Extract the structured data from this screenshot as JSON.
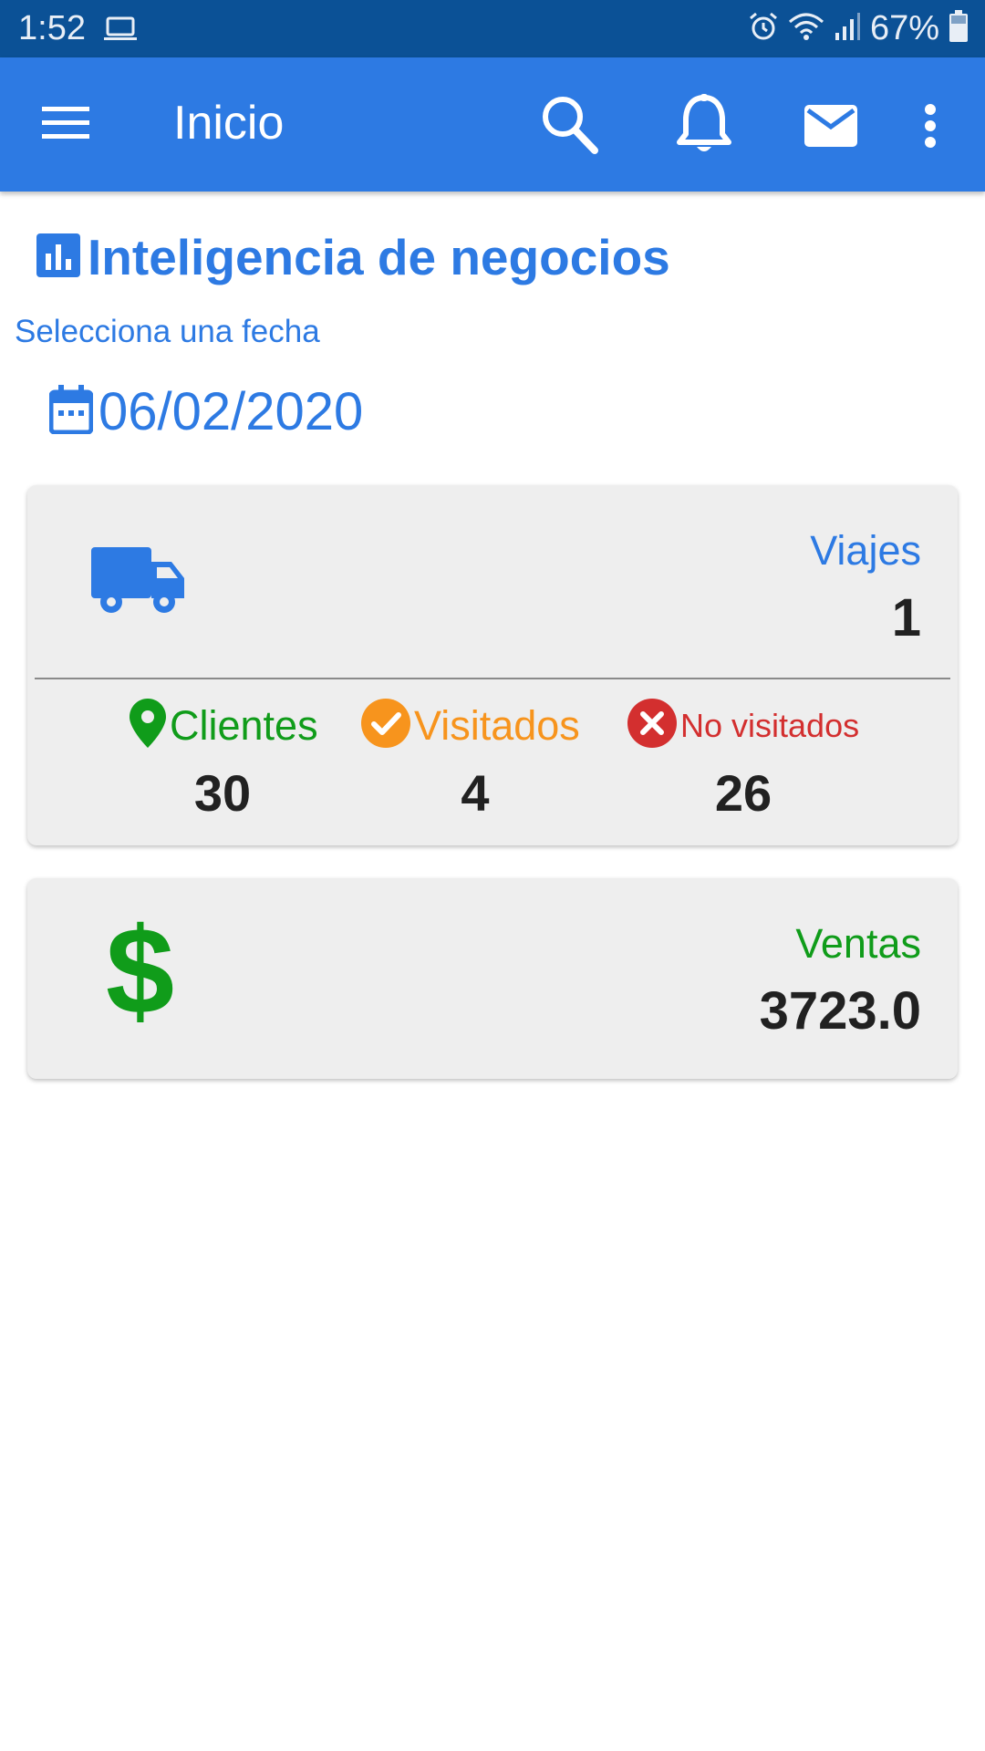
{
  "status_bar": {
    "time": "1:52",
    "battery": "67%",
    "icons": [
      "laptop-icon",
      "alarm-icon",
      "wifi-icon",
      "signal-icon",
      "battery-icon"
    ]
  },
  "app_bar": {
    "title": "Inicio",
    "icons": [
      "menu-icon",
      "search-icon",
      "bell-icon",
      "mail-icon",
      "more-vert-icon"
    ]
  },
  "section": {
    "title": "Inteligencia de negocios",
    "icon": "bar-chart-icon"
  },
  "date_picker": {
    "label": "Selecciona una fecha",
    "value": "06/02/2020",
    "icon": "calendar-icon"
  },
  "trips_card": {
    "label": "Viajes",
    "value": "1",
    "icon": "truck-icon",
    "stats": [
      {
        "label": "Clientes",
        "value": "30",
        "icon": "location-pin-icon",
        "color": "#109c1a"
      },
      {
        "label": "Visitados",
        "value": "4",
        "icon": "check-circle-icon",
        "color": "#f7941d"
      },
      {
        "label": "No visitados",
        "value": "26",
        "icon": "cancel-circle-icon",
        "color": "#d32f2f"
      }
    ]
  },
  "sales_card": {
    "label": "Ventas",
    "value": "3723.0",
    "icon": "dollar-icon",
    "icon_glyph": "$"
  },
  "colors": {
    "status_bar": "#0b5196",
    "app_bar": "#2d7ae3",
    "accent_blue": "#2d7ae3",
    "green": "#109c1a",
    "orange": "#f7941d",
    "red": "#d32f2f",
    "card_bg": "#eeeeee"
  }
}
